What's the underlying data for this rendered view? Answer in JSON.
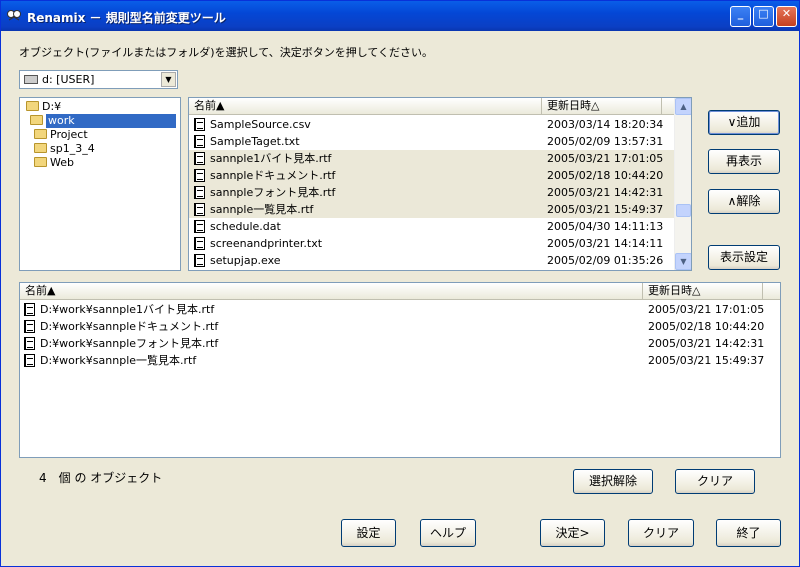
{
  "window": {
    "title": "Renamix － 規則型名前変更ツール"
  },
  "titlebar_buttons": {
    "minimize": "_",
    "maximize": "□",
    "close": "✕"
  },
  "instruction": "オブジェクト(ファイルまたはフォルダ)を選択して、決定ボタンを押してください。",
  "drive": {
    "selected": "d: [USER]",
    "arrow": "▼"
  },
  "folder_tree": [
    {
      "label": "D:¥"
    },
    {
      "label": "work"
    },
    {
      "label": "Project"
    },
    {
      "label": "sp1_3_4"
    },
    {
      "label": "Web"
    }
  ],
  "file_list": {
    "columns": {
      "name": "名前▲",
      "date": "更新日時△"
    },
    "rows": [
      {
        "name": "SampleSource.csv",
        "date": "2003/03/14 18:20:34"
      },
      {
        "name": "SampleTaget.txt",
        "date": "2005/02/09 13:57:31"
      },
      {
        "name": "sannple1バイト見本.rtf",
        "date": "2005/03/21 17:01:05"
      },
      {
        "name": "sannpleドキュメント.rtf",
        "date": "2005/02/18 10:44:20"
      },
      {
        "name": "sannpleフォント見本.rtf",
        "date": "2005/03/21 14:42:31"
      },
      {
        "name": "sannple一覧見本.rtf",
        "date": "2005/03/21 15:49:37"
      },
      {
        "name": "schedule.dat",
        "date": "2005/04/30 14:11:13"
      },
      {
        "name": "screenandprinter.txt",
        "date": "2005/03/21 14:14:11"
      },
      {
        "name": "setupjap.exe",
        "date": "2005/02/09 01:35:26"
      }
    ],
    "scroll_up": "▲",
    "scroll_down": "▼"
  },
  "side_buttons": {
    "add": "∨追加",
    "refresh": "再表示",
    "remove": "∧解除",
    "display_settings": "表示設定"
  },
  "selected_list": {
    "columns": {
      "name": "名前▲",
      "date": "更新日時△"
    },
    "rows": [
      {
        "name": "D:¥work¥sannple1バイト見本.rtf",
        "date": "2005/03/21 17:01:05"
      },
      {
        "name": "D:¥work¥sannpleドキュメント.rtf",
        "date": "2005/02/18 10:44:20"
      },
      {
        "name": "D:¥work¥sannpleフォント見本.rtf",
        "date": "2005/03/21 14:42:31"
      },
      {
        "name": "D:¥work¥sannple一覧見本.rtf",
        "date": "2005/03/21 15:49:37"
      }
    ]
  },
  "object_count": "4　個 の オブジェクト",
  "mid_buttons": {
    "deselect": "選択解除",
    "clear": "クリア"
  },
  "bottom_buttons": {
    "settings": "設定",
    "help": "ヘルプ",
    "decide": "決定>",
    "clear": "クリア",
    "exit": "終了"
  }
}
